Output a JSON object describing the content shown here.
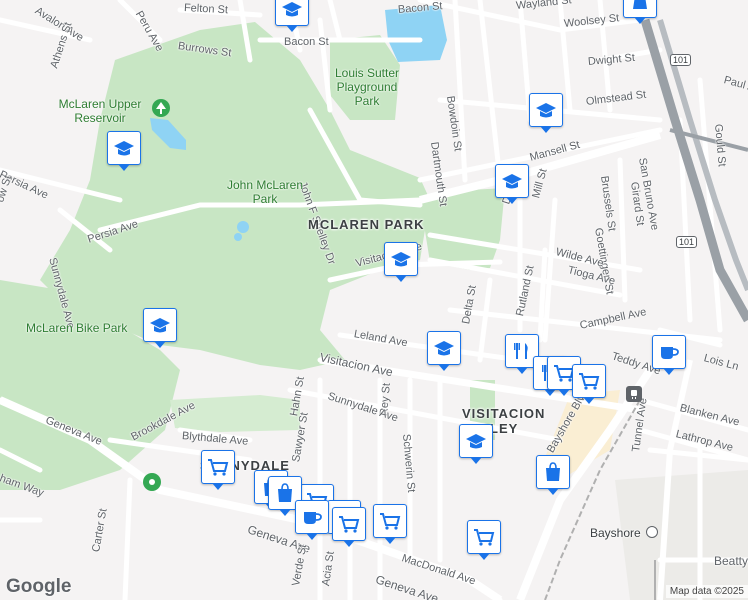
{
  "map": {
    "attribution": "Map data ©2025",
    "logo": "Google",
    "colors": {
      "park": "#c8e6c4",
      "water": "#8fd3f4",
      "highway": "#9aa0a6",
      "marker": "#1a73e8"
    }
  },
  "streets": [
    "Avalon Ave",
    "Peru Ave",
    "Felton St",
    "Bacon St",
    "Wayland St",
    "Woolsey St",
    "Burrows St",
    "Athens St",
    "Bacon St",
    "Dwight St",
    "Paul Ave",
    "Olmstead St",
    "Bowdoin St",
    "Dartmouth St",
    "Mansell St",
    "Brussels St",
    "Girard St",
    "San Bruno Ave",
    "Gould St",
    "Persia Ave",
    "Persia Ave",
    "John F Shelley Dr",
    "Delta St",
    "Mill St",
    "Goettingen St",
    "Wilde Ave",
    "Sunnydale Ave",
    "Tioga Ave",
    "Visitacion Ave",
    "Rutland St",
    "Delta St",
    "Campbell Ave",
    "Leland Ave",
    "Teddy Ave",
    "Lois Ln",
    "Visitacion Ave",
    "Hahn St",
    "Rey St",
    "Schwerin St",
    "Sunnydale Ave",
    "Blanken Ave",
    "Lathrop Ave",
    "Tunnel Ave",
    "Geneva Ave",
    "Brookdale Ave",
    "Blythdale Ave",
    "Sawyer St",
    "Bayshore Blvd",
    "Carter St",
    "Geneva Ave",
    "MacDonald Ave",
    "Geneva Ave",
    "Verde St",
    "Acia St",
    "Beatty",
    "ham Way",
    "ow St"
  ],
  "parks": [
    "Louis Sutter Playground Park",
    "McLaren Upper Reservoir",
    "John McLaren Park",
    "McLaren Bike Park"
  ],
  "areas": [
    "MCLAREN PARK",
    "VISITACION VALLEY",
    "SUNNYDALE"
  ],
  "places": [
    "Bayshore"
  ],
  "shields": [
    "101",
    "101"
  ],
  "markers": [
    "school-marker",
    "school-marker",
    "school-marker",
    "school-marker",
    "school-marker",
    "school-marker",
    "school-marker",
    "school-marker",
    "school-marker",
    "restaurant-marker",
    "restaurant-marker",
    "grocery-marker",
    "grocery-marker",
    "grocery-marker",
    "grocery-marker",
    "grocery-marker",
    "grocery-marker",
    "grocery-marker",
    "grocery-marker",
    "shopping-marker",
    "shopping-marker",
    "shopping-marker",
    "cafe-marker"
  ]
}
